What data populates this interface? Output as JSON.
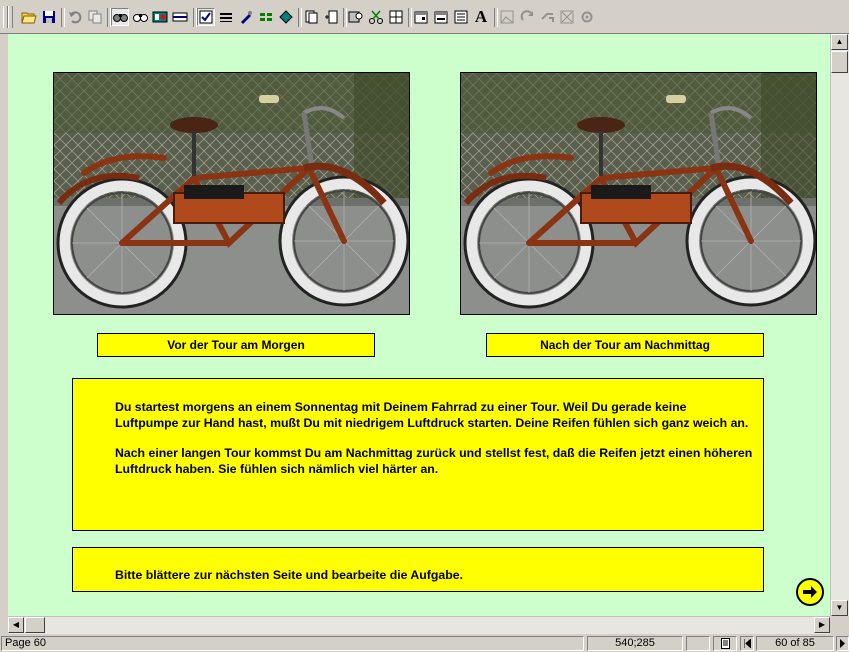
{
  "toolbar": {
    "icons": [
      "open-icon",
      "save-icon",
      "undo-icon",
      "copy-icon",
      "binoculars-icon",
      "binoculars-outline-icon",
      "color-palette-icon",
      "bar-icon",
      "checkbox-icon",
      "lines-icon",
      "brush-icon",
      "grid-icon",
      "shape-icon",
      "page-icon",
      "add-page-icon",
      "zoom-icon",
      "scissors-icon",
      "table-icon",
      "form-icon",
      "form2-icon",
      "list-icon",
      "font-icon",
      "image-icon",
      "rotate-icon",
      "link-icon",
      "cross-image-icon",
      "settings-icon"
    ],
    "font_glyph": "A"
  },
  "page": {
    "background": "#ccffcc",
    "box_color": "#ffff00",
    "left_caption": "Vor der Tour am Morgen",
    "right_caption": "Nach der Tour am Nachmittag",
    "story_p1": "Du startest morgens an einem Sonnentag mit Deinem Fahrrad zu einer Tour. Weil Du gerade keine Luftpumpe zur Hand hast, mußt Du mit niedrigem Luftdruck starten. Deine Reifen fühlen sich ganz weich an.",
    "story_p2": "Nach einer langen Tour kommst Du am Nachmittag zurück und stellst fest, daß die Reifen jetzt einen höheren Luftdruck haben. Sie fühlen sich nämlich viel härter an.",
    "instruction": "Bitte blättere zur nächsten Seite und bearbeite die Aufgabe.",
    "next_icon": "arrow-right-circle-icon"
  },
  "status": {
    "page_label": "Page 60",
    "coords": "540;285",
    "page_counter": "60 of 85"
  }
}
